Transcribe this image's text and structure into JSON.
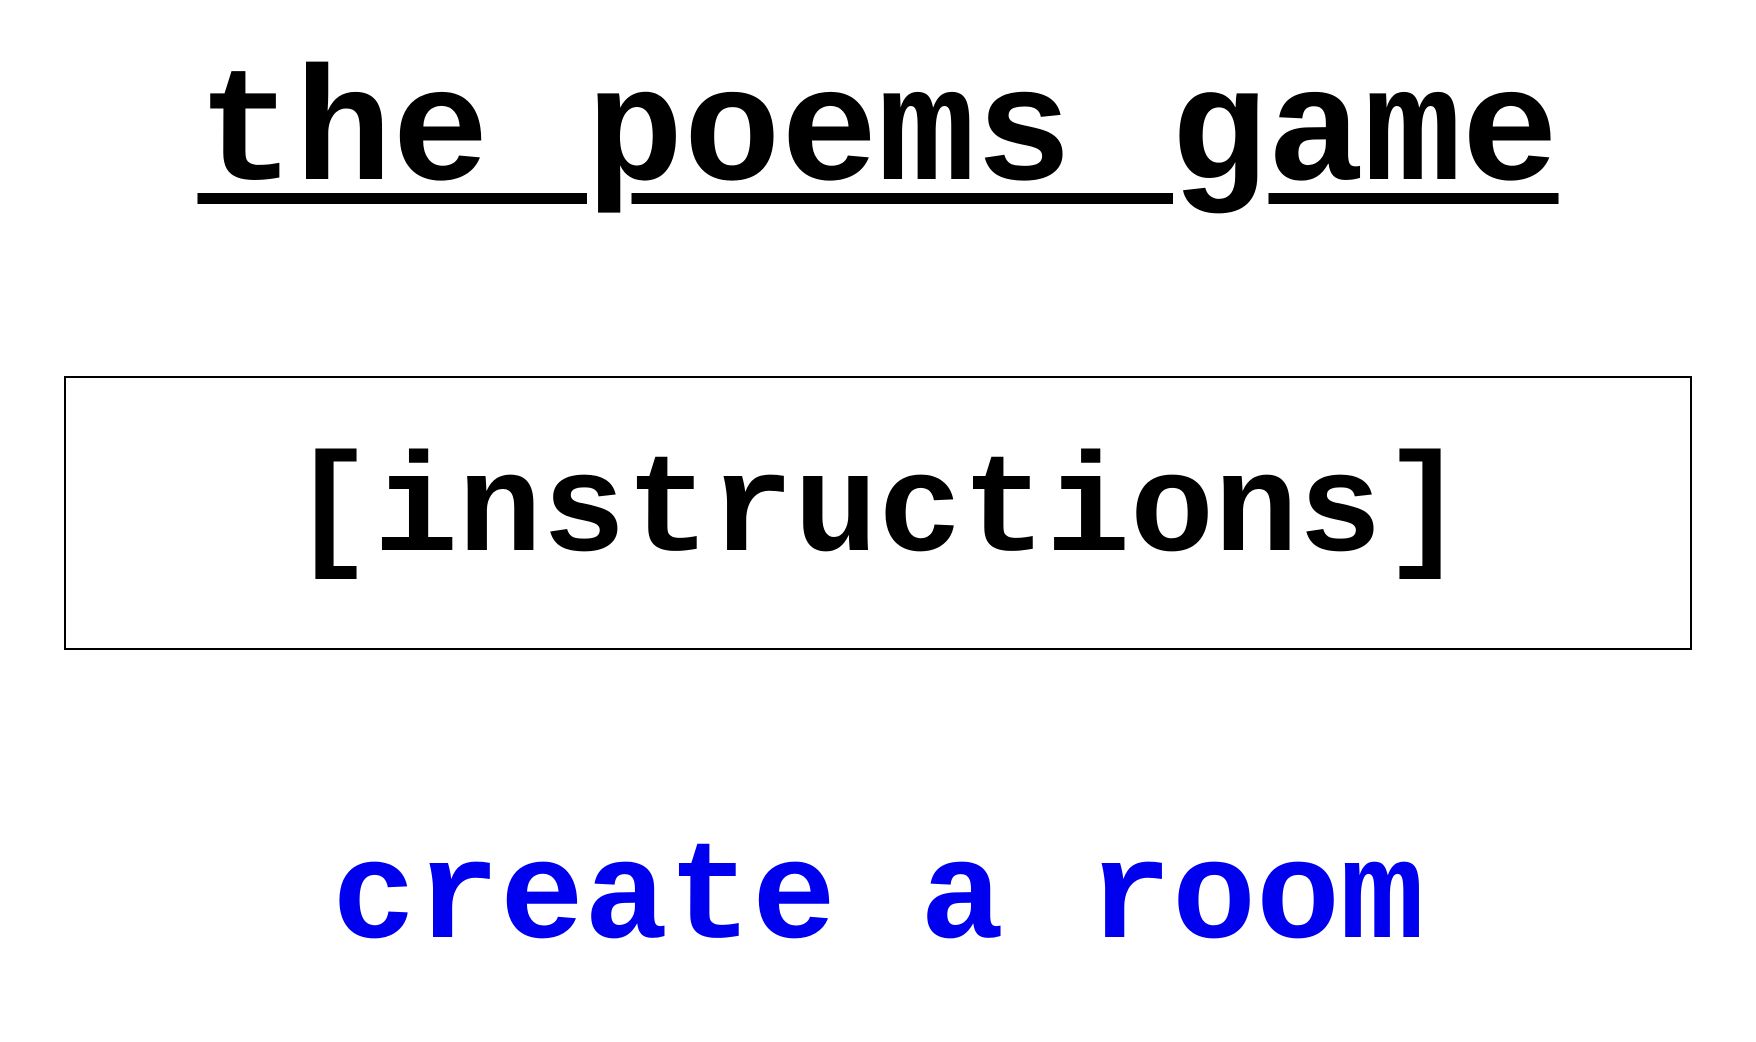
{
  "page": {
    "title": "the poems game"
  },
  "instructions": {
    "label": "[instructions]"
  },
  "create_room": {
    "label": "create a room"
  },
  "colors": {
    "text": "#000000",
    "link": "#0000ee",
    "background": "#ffffff"
  }
}
